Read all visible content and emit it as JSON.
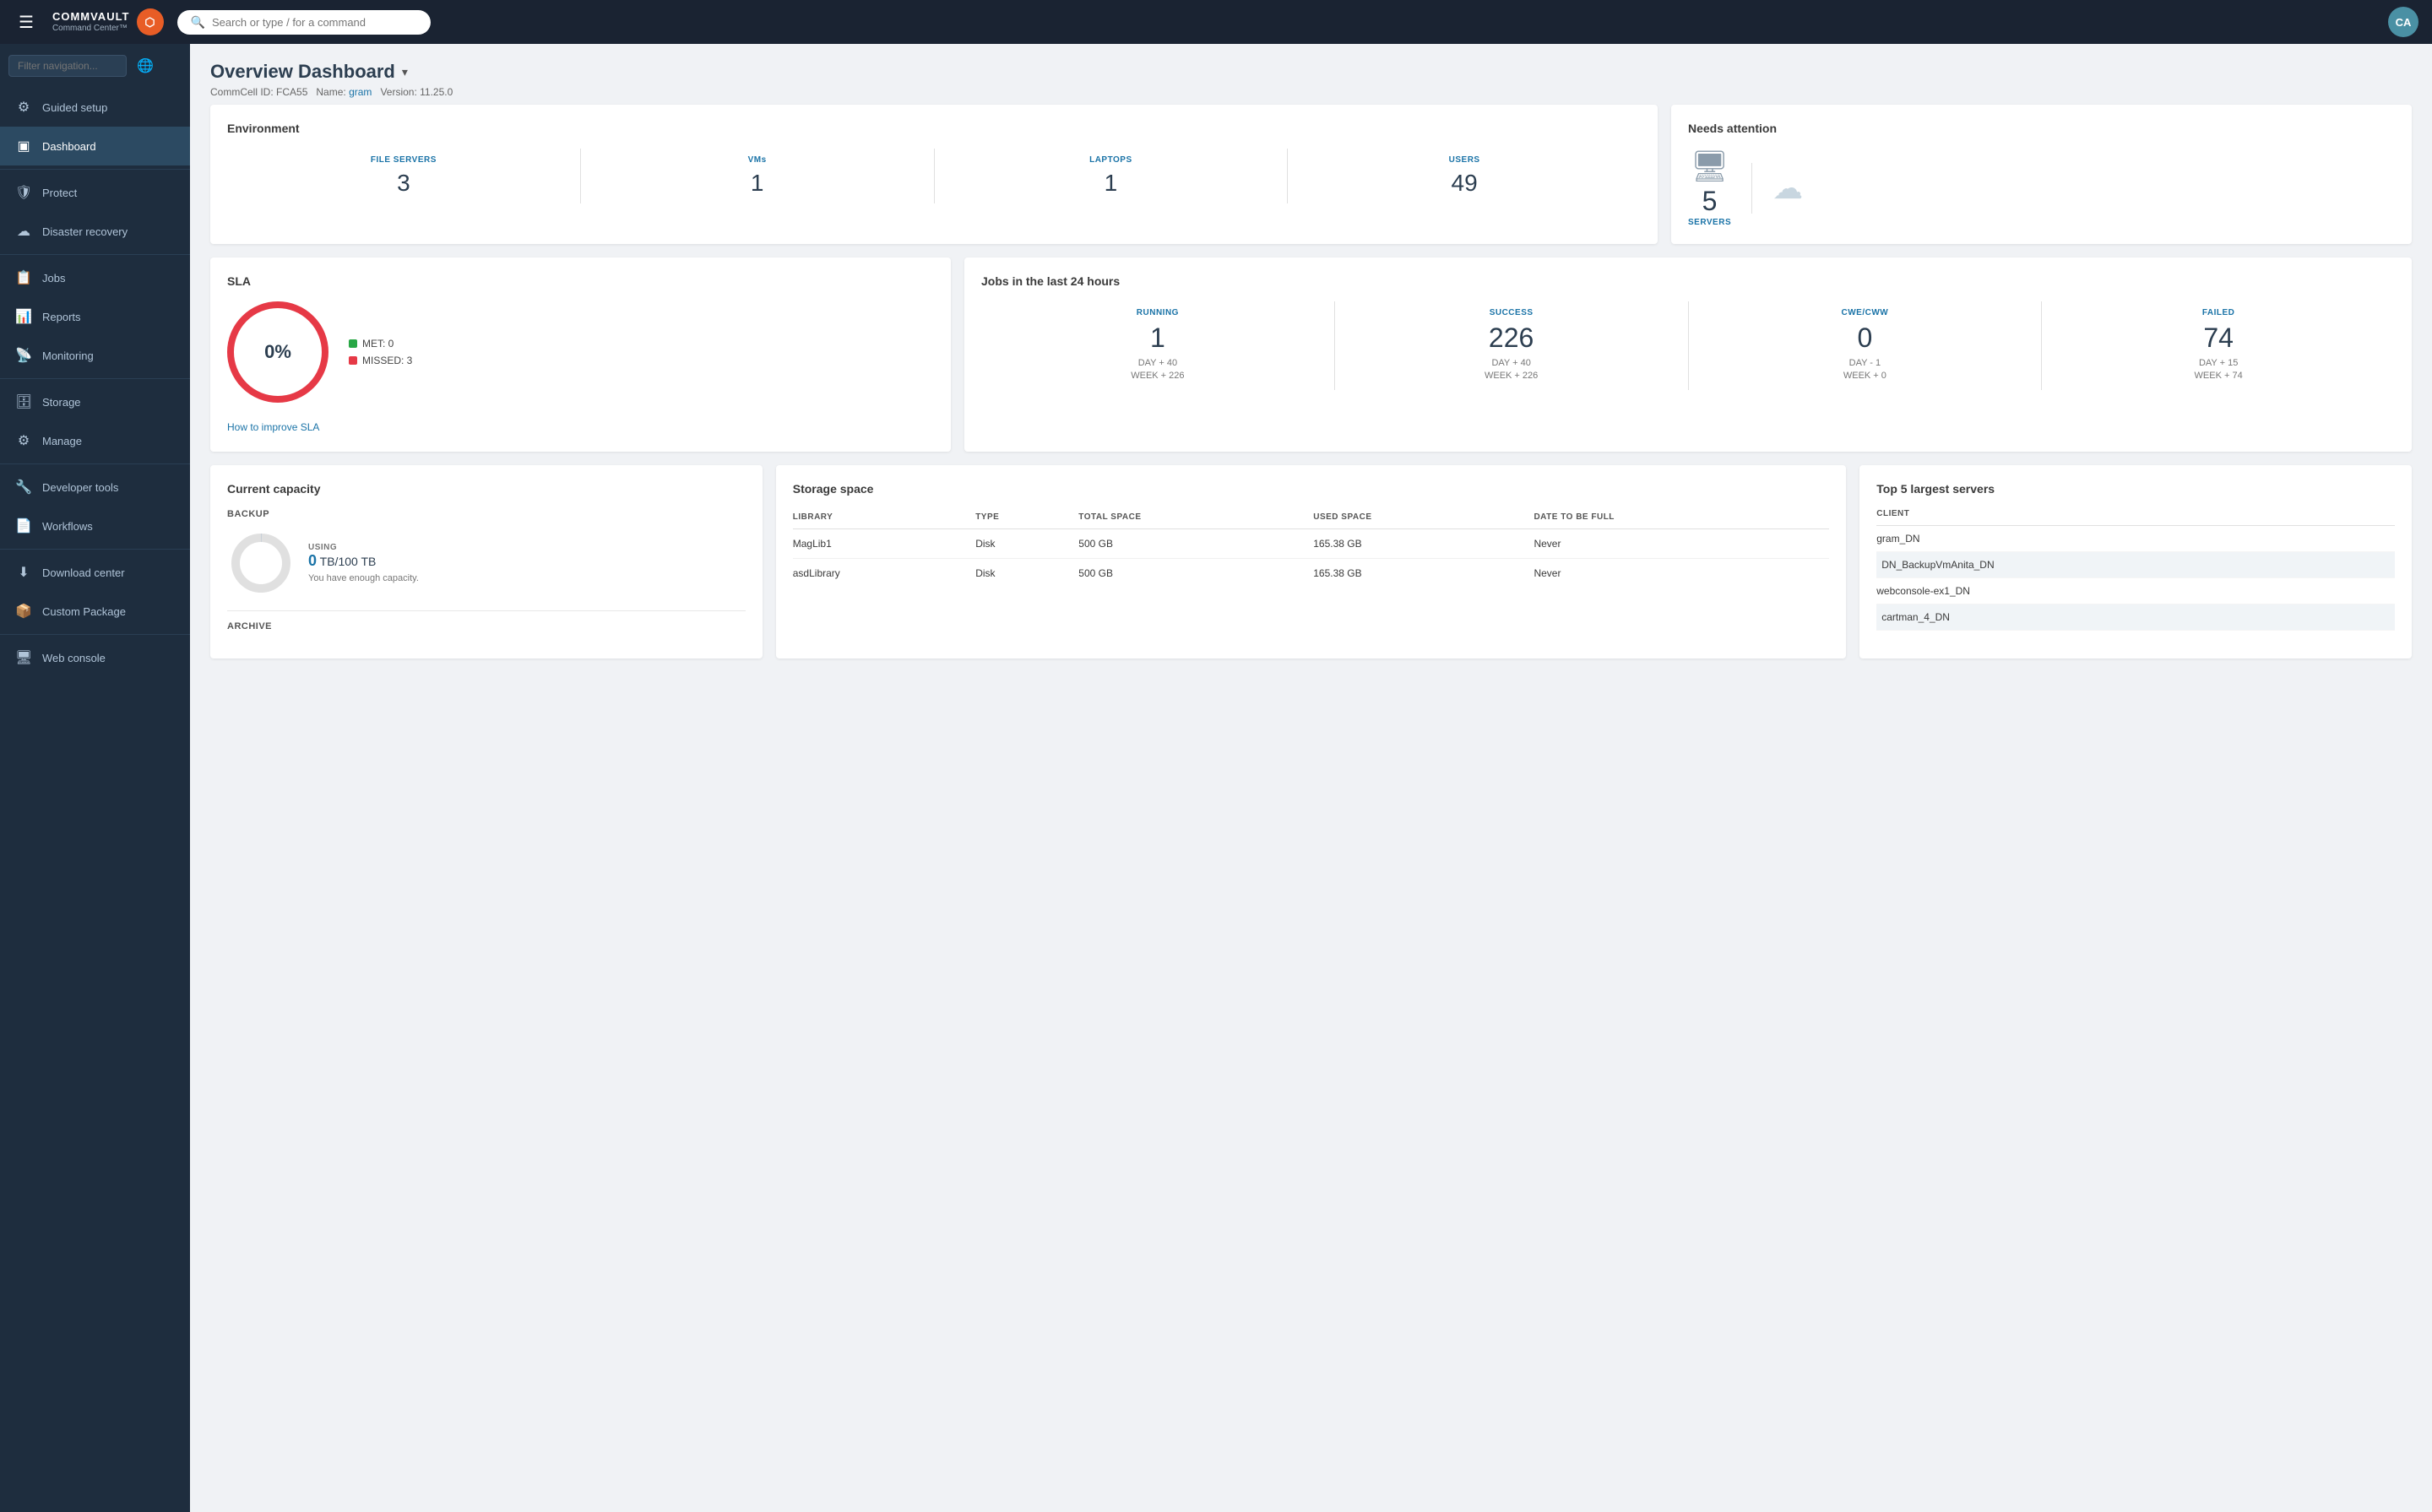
{
  "topnav": {
    "menu_icon": "☰",
    "logo_text": "COMMVAULT",
    "logo_sub": "Command Center™",
    "logo_icon": "⬡",
    "search_placeholder": "Search or type / for a command",
    "avatar_text": "CA"
  },
  "sidebar": {
    "filter_placeholder": "Filter navigation...",
    "globe_icon": "🌐",
    "items": [
      {
        "id": "guided-setup",
        "icon": "⚙",
        "label": "Guided setup"
      },
      {
        "id": "dashboard",
        "icon": "▣",
        "label": "Dashboard",
        "active": true
      },
      {
        "id": "protect",
        "icon": "🛡",
        "label": "Protect"
      },
      {
        "id": "disaster-recovery",
        "icon": "☁",
        "label": "Disaster recovery"
      },
      {
        "id": "jobs",
        "icon": "📋",
        "label": "Jobs"
      },
      {
        "id": "reports",
        "icon": "📊",
        "label": "Reports"
      },
      {
        "id": "monitoring",
        "icon": "📡",
        "label": "Monitoring"
      },
      {
        "id": "storage",
        "icon": "🗄",
        "label": "Storage"
      },
      {
        "id": "manage",
        "icon": "⚙",
        "label": "Manage"
      },
      {
        "id": "developer-tools",
        "icon": "🔧",
        "label": "Developer tools"
      },
      {
        "id": "workflows",
        "icon": "📄",
        "label": "Workflows"
      },
      {
        "id": "download-center",
        "icon": "⬇",
        "label": "Download center"
      },
      {
        "id": "custom-package",
        "icon": "📦",
        "label": "Custom Package"
      },
      {
        "id": "web-console",
        "icon": "🖥",
        "label": "Web console"
      }
    ]
  },
  "page": {
    "title": "Overview Dashboard",
    "dropdown_icon": "▾",
    "meta_commcell": "CommCell ID:",
    "meta_commcell_value": "FCA55",
    "meta_name": "Name:",
    "meta_name_value": "gram",
    "meta_version": "Version:",
    "meta_version_value": "11.25.0"
  },
  "environment": {
    "title": "Environment",
    "metrics": [
      {
        "label": "FILE SERVERS",
        "value": "3"
      },
      {
        "label": "VMs",
        "value": "1"
      },
      {
        "label": "LAPTOPS",
        "value": "1"
      },
      {
        "label": "USERS",
        "value": "49"
      }
    ]
  },
  "attention": {
    "title": "Needs attention",
    "items": [
      {
        "icon": "🖥",
        "count": "5",
        "label": "SERVERS"
      },
      {
        "icon": "☁",
        "count": "",
        "label": ""
      }
    ]
  },
  "sla": {
    "title": "SLA",
    "percent": "0%",
    "legend": [
      {
        "color": "green",
        "label": "MET: 0"
      },
      {
        "color": "red",
        "label": "MISSED: 3"
      }
    ],
    "link": "How to improve SLA"
  },
  "jobs": {
    "title": "Jobs in the last 24 hours",
    "metrics": [
      {
        "label": "RUNNING",
        "value": "1",
        "delta1": "DAY + 40",
        "delta2": "WEEK + 226"
      },
      {
        "label": "SUCCESS",
        "value": "226",
        "delta1": "DAY + 40",
        "delta2": "WEEK + 226"
      },
      {
        "label": "CWE/CWW",
        "value": "0",
        "delta1": "DAY - 1",
        "delta2": "WEEK + 0"
      },
      {
        "label": "FAILED",
        "value": "74",
        "delta1": "DAY + 15",
        "delta2": "WEEK + 74"
      }
    ]
  },
  "capacity": {
    "title": "Current capacity",
    "backup_title": "BACKUP",
    "archive_title": "ARCHIVE",
    "using_label": "USING",
    "backup_used": "0",
    "backup_total": "100",
    "backup_unit": "TB",
    "note": "You have enough capacity."
  },
  "storage": {
    "title": "Storage space",
    "columns": [
      "LIBRARY",
      "TYPE",
      "TOTAL SPACE",
      "USED SPACE",
      "DATE TO BE FULL"
    ],
    "rows": [
      {
        "library": "MagLib1",
        "type": "Disk",
        "total": "500 GB",
        "used": "165.38 GB",
        "date": "Never"
      },
      {
        "library": "asdLibrary",
        "type": "Disk",
        "total": "500 GB",
        "used": "165.38 GB",
        "date": "Never"
      }
    ]
  },
  "top_servers": {
    "title": "Top 5 largest servers",
    "column": "CLIENT",
    "rows": [
      "gram_DN",
      "DN_BackupVmAnita_DN",
      "webconsole-ex1_DN",
      "cartman_4_DN"
    ]
  }
}
